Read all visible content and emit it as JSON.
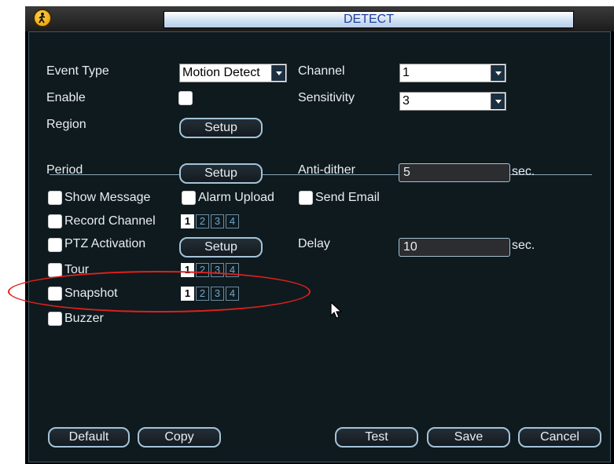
{
  "window": {
    "title": "DETECT"
  },
  "form": {
    "event_type_label": "Event Type",
    "event_type_value": "Motion Detect",
    "channel_label": "Channel",
    "channel_value": "1",
    "enable_label": "Enable",
    "sensitivity_label": "Sensitivity",
    "sensitivity_value": "3",
    "region_label": "Region",
    "region_button": "Setup",
    "period_label": "Period",
    "period_button": "Setup",
    "antidither_label": "Anti-dither",
    "antidither_value": "5",
    "antidither_unit": "sec.",
    "show_message_label": "Show Message",
    "alarm_upload_label": "Alarm Upload",
    "send_email_label": "Send Email",
    "record_channel_label": "Record Channel",
    "ptz_label": "PTZ Activation",
    "ptz_button": "Setup",
    "delay_label": "Delay",
    "delay_value": "10",
    "delay_unit": "sec.",
    "tour_label": "Tour",
    "snapshot_label": "Snapshot",
    "buzzer_label": "Buzzer",
    "channels": [
      "1",
      "2",
      "3",
      "4"
    ]
  },
  "footer": {
    "default_label": "Default",
    "copy_label": "Copy",
    "test_label": "Test",
    "save_label": "Save",
    "cancel_label": "Cancel"
  },
  "colors": {
    "highlight_ellipse": "#e0201c",
    "title_text": "#1f3f9e"
  }
}
